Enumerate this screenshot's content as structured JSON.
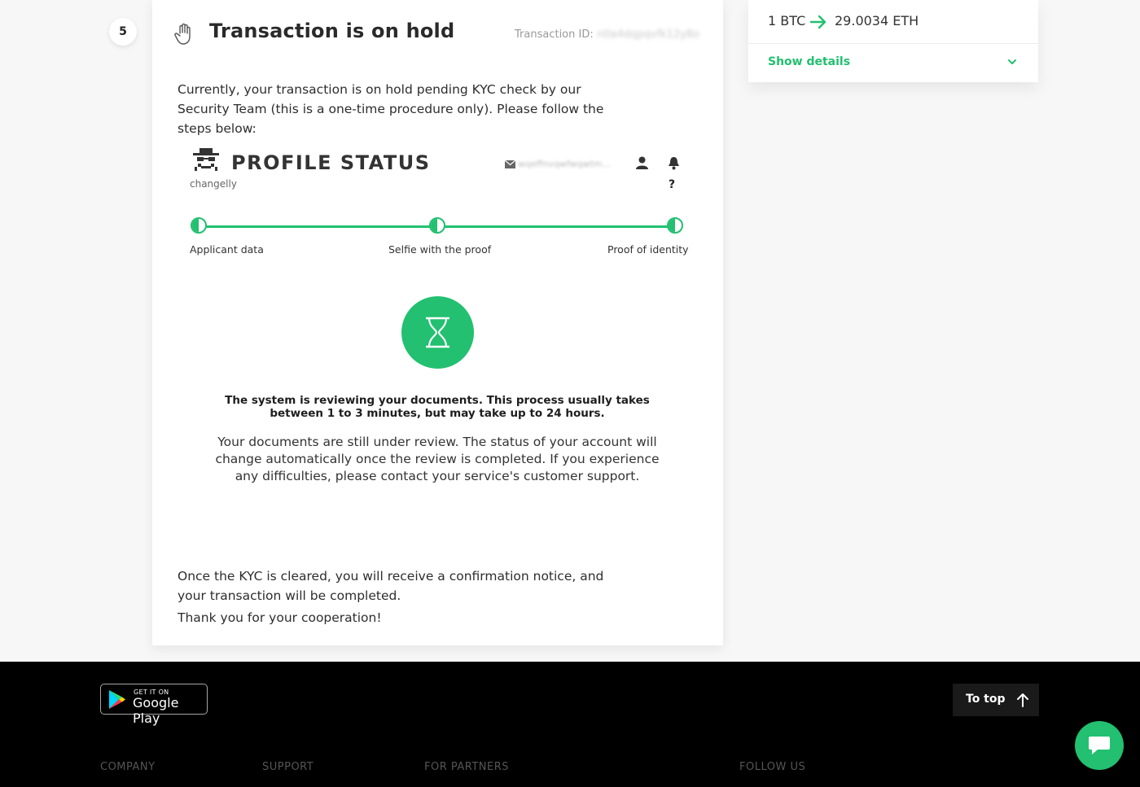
{
  "step": {
    "number": "5"
  },
  "header": {
    "title": "Transaction is on hold",
    "txid_label": "Transaction ID:",
    "txid_value": "n0a4dqpqvfk12y8o"
  },
  "intro_text": "Currently, your transaction is on hold pending KYC check by our Security Team (this is a one-time procedure only). Please follow the steps below:",
  "profile_status": {
    "title": "PROFILE STATUS",
    "brand": "changelly",
    "email": "wqeffnvqwfwqwtm...",
    "help_label": "?",
    "steps": [
      {
        "label": "Applicant data"
      },
      {
        "label": "Selfie with the proof"
      },
      {
        "label": "Proof of identity"
      }
    ],
    "review_bold": "The system is reviewing your documents. This process usually takes between 1 to 3 minutes, but may take up to 24 hours.",
    "review_text": "Your documents are still under review. The status of your account will change automatically once the review is completed. If you experience any difficulties, please contact your service's customer support."
  },
  "outro_text": "Once the KYC is cleared, you will receive a confirmation notice, and your transaction will be completed.",
  "thanks_text": "Thank you for your cooperation!",
  "exchange": {
    "from": "1 BTC",
    "to": "29.0034 ETH",
    "show_details": "Show details"
  },
  "footer": {
    "gplay_top": "GET IT ON",
    "gplay_main": "Google Play",
    "to_top": "To top",
    "columns": [
      "COMPANY",
      "SUPPORT",
      "FOR PARTNERS",
      "FOLLOW US"
    ]
  },
  "colors": {
    "accent": "#22c070",
    "footer_bg": "#000000",
    "page_bg": "#f7f7f7"
  }
}
